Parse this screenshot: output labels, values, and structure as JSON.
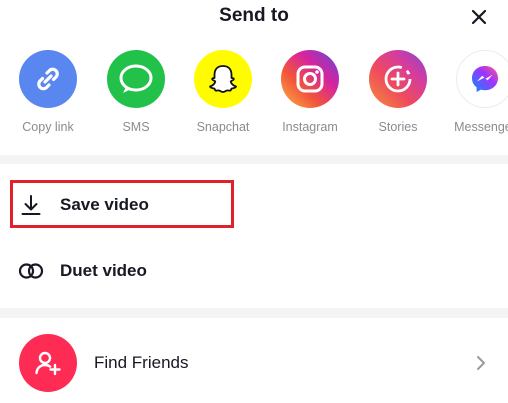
{
  "header": {
    "title": "Send to",
    "close_icon": "close-icon"
  },
  "apps": [
    {
      "label": "Copy link",
      "icon": "link-icon",
      "color": "#5a86f0"
    },
    {
      "label": "SMS",
      "icon": "chat-bubble-icon",
      "color": "#22c14a"
    },
    {
      "label": "Snapchat",
      "icon": "ghost-icon",
      "color": "#fffc00"
    },
    {
      "label": "Instagram",
      "icon": "camera-icon",
      "color": "#d6249f"
    },
    {
      "label": "Stories",
      "icon": "story-plus-icon",
      "color": "#e8457a"
    },
    {
      "label": "Messenger",
      "icon": "messenger-icon",
      "color": "#7b5cff"
    }
  ],
  "actions": {
    "save_video": {
      "label": "Save video",
      "icon": "download-icon"
    },
    "duet_video": {
      "label": "Duet video",
      "icon": "duet-icon"
    }
  },
  "find_friends": {
    "label": "Find Friends",
    "icon": "add-user-icon",
    "chevron": "chevron-right-icon",
    "color": "#fe2c55"
  },
  "highlight_color": "#e0202a"
}
